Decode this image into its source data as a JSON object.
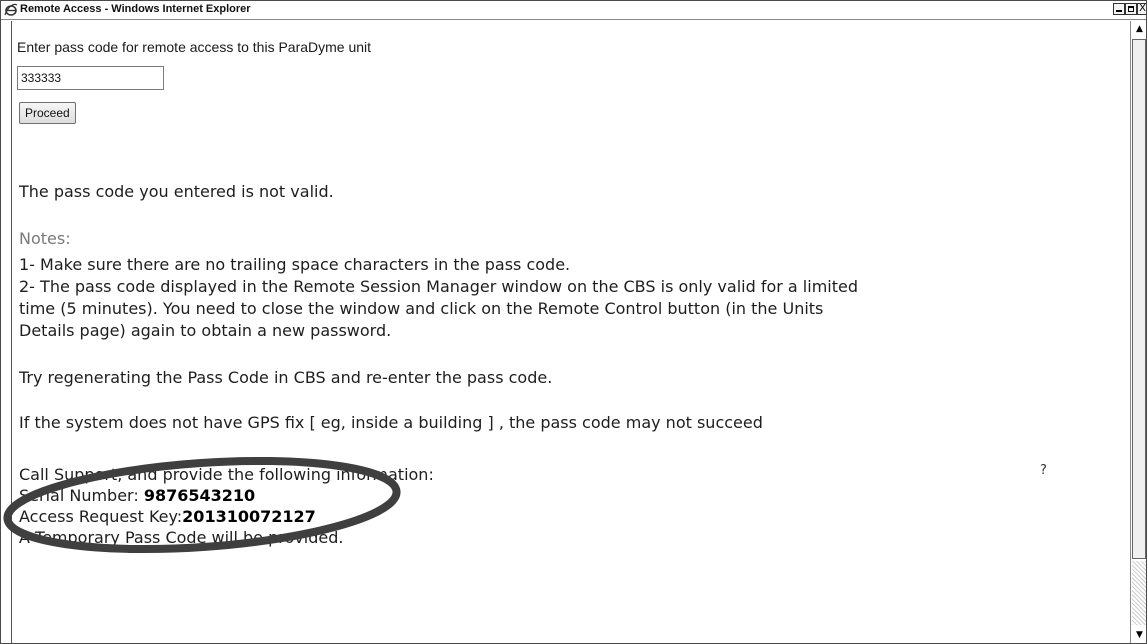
{
  "window": {
    "title": "Remote Access - Windows Internet Explorer"
  },
  "icons": {
    "browser": "ie-icon",
    "minimize": "minimize-icon",
    "maximize": "maximize-icon",
    "close": "close-icon",
    "scroll_up": "scroll-up-arrow-icon",
    "scroll_down": "scroll-down-arrow-icon"
  },
  "controls": {
    "close_glyph": "X",
    "scroll_up_glyph": "▲",
    "scroll_down_glyph": "▼"
  },
  "form": {
    "prompt": "Enter pass code for remote access to this ParaDyme unit",
    "passcode_value": "333333",
    "proceed_label": "Proceed"
  },
  "messages": {
    "invalid": "The pass code you entered is not valid.",
    "notes_label": "Notes:",
    "note1": "1- Make sure there are no trailing space characters in the pass code.",
    "note2_lines": [
      "2- The pass code displayed in the Remote Session Manager window on the CBS is only valid for a limited",
      "time (5 minutes). You need to close the window and click on the Remote Control button (in the Units",
      "Details page) again to obtain a new password."
    ],
    "try_regen": "Try regenerating the Pass Code in CBS and re-enter the pass code.",
    "gps_note": "If the system does not have GPS fix [ eg, inside a building ] , the pass code may not succeed",
    "call_support": "Call Support, and provide the following information:",
    "serial_label": "Serial Number: ",
    "serial_value": "9876543210",
    "request_key_label": "Access Request Key:",
    "request_key_value": "201310072127",
    "temp_code": "A Temporary Pass Code will be provided.",
    "stray_mark": "?"
  },
  "colors": {
    "annotation_ellipse": "#3f3f3f",
    "notes_label": "#7a7a7a"
  }
}
